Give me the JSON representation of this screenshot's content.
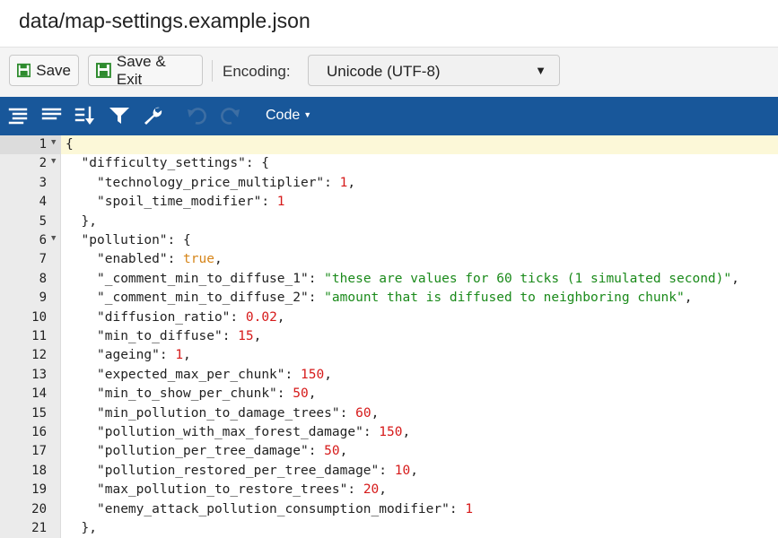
{
  "title": "data/map-settings.example.json",
  "buttons": {
    "save": "Save",
    "save_exit": "Save & Exit"
  },
  "encoding": {
    "label": "Encoding:",
    "value": "Unicode (UTF-8)"
  },
  "toolbar": {
    "mode": "Code",
    "icons": [
      "format-icon",
      "compact-icon",
      "sort-icon",
      "filter-icon",
      "repair-icon",
      "undo-icon",
      "redo-icon"
    ]
  },
  "editor": {
    "lines": [
      {
        "n": "1",
        "fold": true,
        "indent": 0,
        "tokens": [
          {
            "t": "{",
            "c": "punc"
          }
        ]
      },
      {
        "n": "2",
        "fold": true,
        "indent": 1,
        "tokens": [
          {
            "t": "\"difficulty_settings\"",
            "c": "key"
          },
          {
            "t": ": {",
            "c": "punc"
          }
        ]
      },
      {
        "n": "3",
        "fold": false,
        "indent": 2,
        "tokens": [
          {
            "t": "\"technology_price_multiplier\"",
            "c": "key"
          },
          {
            "t": ": ",
            "c": "punc"
          },
          {
            "t": "1",
            "c": "num"
          },
          {
            "t": ",",
            "c": "punc"
          }
        ]
      },
      {
        "n": "4",
        "fold": false,
        "indent": 2,
        "tokens": [
          {
            "t": "\"spoil_time_modifier\"",
            "c": "key"
          },
          {
            "t": ": ",
            "c": "punc"
          },
          {
            "t": "1",
            "c": "num"
          }
        ]
      },
      {
        "n": "5",
        "fold": false,
        "indent": 1,
        "tokens": [
          {
            "t": "},",
            "c": "punc"
          }
        ]
      },
      {
        "n": "6",
        "fold": true,
        "indent": 1,
        "tokens": [
          {
            "t": "\"pollution\"",
            "c": "key"
          },
          {
            "t": ": {",
            "c": "punc"
          }
        ]
      },
      {
        "n": "7",
        "fold": false,
        "indent": 2,
        "tokens": [
          {
            "t": "\"enabled\"",
            "c": "key"
          },
          {
            "t": ": ",
            "c": "punc"
          },
          {
            "t": "true",
            "c": "bool"
          },
          {
            "t": ",",
            "c": "punc"
          }
        ]
      },
      {
        "n": "8",
        "fold": false,
        "indent": 2,
        "tokens": [
          {
            "t": "\"_comment_min_to_diffuse_1\"",
            "c": "key"
          },
          {
            "t": ": ",
            "c": "punc"
          },
          {
            "t": "\"these are values for 60 ticks (1 simulated second)\"",
            "c": "str"
          },
          {
            "t": ",",
            "c": "punc"
          }
        ]
      },
      {
        "n": "9",
        "fold": false,
        "indent": 2,
        "tokens": [
          {
            "t": "\"_comment_min_to_diffuse_2\"",
            "c": "key"
          },
          {
            "t": ": ",
            "c": "punc"
          },
          {
            "t": "\"amount that is diffused to neighboring chunk\"",
            "c": "str"
          },
          {
            "t": ",",
            "c": "punc"
          }
        ]
      },
      {
        "n": "10",
        "fold": false,
        "indent": 2,
        "tokens": [
          {
            "t": "\"diffusion_ratio\"",
            "c": "key"
          },
          {
            "t": ": ",
            "c": "punc"
          },
          {
            "t": "0.02",
            "c": "num"
          },
          {
            "t": ",",
            "c": "punc"
          }
        ]
      },
      {
        "n": "11",
        "fold": false,
        "indent": 2,
        "tokens": [
          {
            "t": "\"min_to_diffuse\"",
            "c": "key"
          },
          {
            "t": ": ",
            "c": "punc"
          },
          {
            "t": "15",
            "c": "num"
          },
          {
            "t": ",",
            "c": "punc"
          }
        ]
      },
      {
        "n": "12",
        "fold": false,
        "indent": 2,
        "tokens": [
          {
            "t": "\"ageing\"",
            "c": "key"
          },
          {
            "t": ": ",
            "c": "punc"
          },
          {
            "t": "1",
            "c": "num"
          },
          {
            "t": ",",
            "c": "punc"
          }
        ]
      },
      {
        "n": "13",
        "fold": false,
        "indent": 2,
        "tokens": [
          {
            "t": "\"expected_max_per_chunk\"",
            "c": "key"
          },
          {
            "t": ": ",
            "c": "punc"
          },
          {
            "t": "150",
            "c": "num"
          },
          {
            "t": ",",
            "c": "punc"
          }
        ]
      },
      {
        "n": "14",
        "fold": false,
        "indent": 2,
        "tokens": [
          {
            "t": "\"min_to_show_per_chunk\"",
            "c": "key"
          },
          {
            "t": ": ",
            "c": "punc"
          },
          {
            "t": "50",
            "c": "num"
          },
          {
            "t": ",",
            "c": "punc"
          }
        ]
      },
      {
        "n": "15",
        "fold": false,
        "indent": 2,
        "tokens": [
          {
            "t": "\"min_pollution_to_damage_trees\"",
            "c": "key"
          },
          {
            "t": ": ",
            "c": "punc"
          },
          {
            "t": "60",
            "c": "num"
          },
          {
            "t": ",",
            "c": "punc"
          }
        ]
      },
      {
        "n": "16",
        "fold": false,
        "indent": 2,
        "tokens": [
          {
            "t": "\"pollution_with_max_forest_damage\"",
            "c": "key"
          },
          {
            "t": ": ",
            "c": "punc"
          },
          {
            "t": "150",
            "c": "num"
          },
          {
            "t": ",",
            "c": "punc"
          }
        ]
      },
      {
        "n": "17",
        "fold": false,
        "indent": 2,
        "tokens": [
          {
            "t": "\"pollution_per_tree_damage\"",
            "c": "key"
          },
          {
            "t": ": ",
            "c": "punc"
          },
          {
            "t": "50",
            "c": "num"
          },
          {
            "t": ",",
            "c": "punc"
          }
        ]
      },
      {
        "n": "18",
        "fold": false,
        "indent": 2,
        "tokens": [
          {
            "t": "\"pollution_restored_per_tree_damage\"",
            "c": "key"
          },
          {
            "t": ": ",
            "c": "punc"
          },
          {
            "t": "10",
            "c": "num"
          },
          {
            "t": ",",
            "c": "punc"
          }
        ]
      },
      {
        "n": "19",
        "fold": false,
        "indent": 2,
        "tokens": [
          {
            "t": "\"max_pollution_to_restore_trees\"",
            "c": "key"
          },
          {
            "t": ": ",
            "c": "punc"
          },
          {
            "t": "20",
            "c": "num"
          },
          {
            "t": ",",
            "c": "punc"
          }
        ]
      },
      {
        "n": "20",
        "fold": false,
        "indent": 2,
        "tokens": [
          {
            "t": "\"enemy_attack_pollution_consumption_modifier\"",
            "c": "key"
          },
          {
            "t": ": ",
            "c": "punc"
          },
          {
            "t": "1",
            "c": "num"
          }
        ]
      },
      {
        "n": "21",
        "fold": false,
        "indent": 1,
        "tokens": [
          {
            "t": "},",
            "c": "punc"
          }
        ]
      }
    ]
  },
  "colors": {
    "toolbar": "#18579a",
    "string": "#1a8a1a",
    "number": "#d61a1a",
    "boolean": "#d6851a",
    "active_line": "#fcf8d8"
  }
}
